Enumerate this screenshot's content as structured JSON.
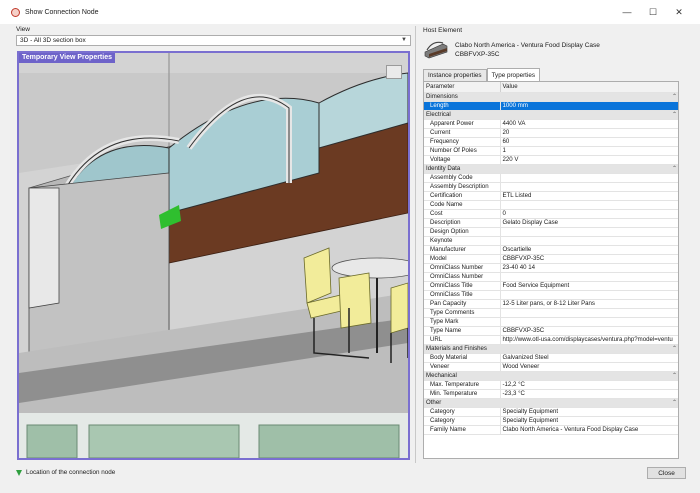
{
  "window": {
    "title": "Show Connection Node",
    "minimize_glyph": "—",
    "maximize_glyph": "☐",
    "close_glyph": "✕"
  },
  "view": {
    "label": "View",
    "selected": "3D - All 3D section box",
    "badge": "Temporary View Properties"
  },
  "host": {
    "label": "Host Element",
    "name": "Clabo North America - Ventura Food Display Case",
    "model": "CBBFVXP-35C"
  },
  "tabs": [
    {
      "label": "Instance properties",
      "active": false
    },
    {
      "label": "Type properties",
      "active": true
    }
  ],
  "grid": {
    "col_param": "Parameter",
    "col_value": "Value",
    "groups": [
      {
        "name": "Dimensions",
        "rows": [
          [
            "Length",
            "1000 mm"
          ]
        ]
      },
      {
        "name": "Electrical",
        "rows": [
          [
            "Apparent Power",
            "4400 VA"
          ],
          [
            "Current",
            "20"
          ],
          [
            "Frequency",
            "60"
          ],
          [
            "Number Of Poles",
            "1"
          ],
          [
            "Voltage",
            "220 V"
          ]
        ]
      },
      {
        "name": "Identity Data",
        "rows": [
          [
            "Assembly Code",
            ""
          ],
          [
            "Assembly Description",
            ""
          ],
          [
            "Certification",
            "ETL Listed"
          ],
          [
            "Code Name",
            ""
          ],
          [
            "Cost",
            "0"
          ],
          [
            "Description",
            "Gelato Display Case"
          ],
          [
            "Design Option",
            ""
          ],
          [
            "Keynote",
            ""
          ],
          [
            "Manufacturer",
            "Oscartielle"
          ],
          [
            "Model",
            "CBBFVXP-35C"
          ],
          [
            "OmniClass Number",
            "23-40 40 14"
          ],
          [
            "OmniClass Number",
            ""
          ],
          [
            "OmniClass Title",
            "Food Service Equipment"
          ],
          [
            "OmniClass Title",
            ""
          ],
          [
            "Pan Capacity",
            "12-5 Liter pans, or 8-12 Liter Pans"
          ],
          [
            "Type Comments",
            ""
          ],
          [
            "Type Mark",
            ""
          ],
          [
            "Type Name",
            "CBBFVXP-35C"
          ],
          [
            "URL",
            "http://www.otl-usa.com/displaycases/ventura.php?model=ventu"
          ]
        ]
      },
      {
        "name": "Materials and Finishes",
        "rows": [
          [
            "Body Material",
            "Galvanized Steel"
          ],
          [
            "Veneer",
            "Wood Veneer"
          ]
        ]
      },
      {
        "name": "Mechanical",
        "rows": [
          [
            "Max. Temperature",
            "-12,2 °C"
          ],
          [
            "Min. Temperature",
            "-23,3 °C"
          ]
        ]
      },
      {
        "name": "Other",
        "rows": [
          [
            "Category",
            "Specialty Equipment"
          ],
          [
            "Category",
            "Specialty Equipment"
          ],
          [
            "Family Name",
            "Clabo North America - Ventura Food Display Case"
          ]
        ]
      }
    ],
    "selected_row": "Length"
  },
  "status": {
    "text": "Location of the connection node",
    "icon": "green-down-arrow-icon"
  },
  "buttons": {
    "close": "Close"
  },
  "colors": {
    "accent": "#0a74da",
    "view_border": "#7a6fd0",
    "badge_bg": "#6e63c9",
    "wood": "#6b3a22",
    "chair": "#f2ec9a",
    "marker": "#2fbf2f"
  }
}
